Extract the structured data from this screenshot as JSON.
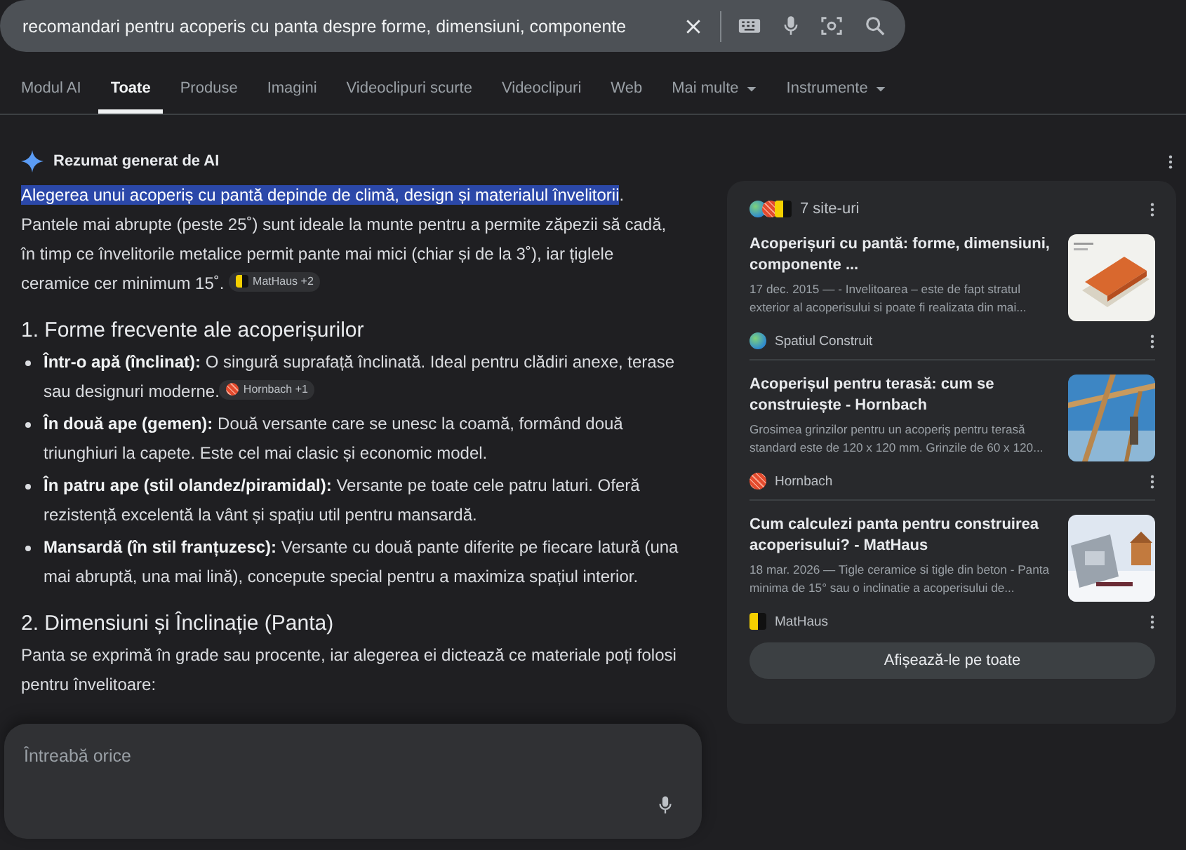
{
  "search": {
    "query": "recomandari pentru acoperis cu panta despre forme, dimensiuni, componente"
  },
  "tabs": [
    {
      "label": "Modul AI",
      "selected": false,
      "dropdown": false
    },
    {
      "label": "Toate",
      "selected": true,
      "dropdown": false
    },
    {
      "label": "Produse",
      "selected": false,
      "dropdown": false
    },
    {
      "label": "Imagini",
      "selected": false,
      "dropdown": false
    },
    {
      "label": "Videoclipuri scurte",
      "selected": false,
      "dropdown": false
    },
    {
      "label": "Videoclipuri",
      "selected": false,
      "dropdown": false
    },
    {
      "label": "Web",
      "selected": false,
      "dropdown": false
    },
    {
      "label": "Mai multe",
      "selected": false,
      "dropdown": true
    },
    {
      "label": "Instrumente",
      "selected": false,
      "dropdown": true
    }
  ],
  "ai_overview": {
    "title": "Rezumat generat de AI",
    "intro": {
      "highlight": "Alegerea unui acoperiș cu pantă depinde de climă, design și materialul învelitorii",
      "text": ". Pantele mai abrupte (peste 25˚) sunt ideale la munte pentru a permite zăpezii să cadă, în timp ce învelitorile metalice permit pante mai mici (chiar și de la 3˚), iar țiglele ceramice cer minimum 15˚.",
      "source": {
        "label": "MatHaus +2",
        "kind": "mathaus"
      }
    },
    "sections": [
      {
        "heading": "1. Forme frecvente ale acoperișurilor",
        "bullets": [
          {
            "text": "**Într-o apă (înclinat):** O singură suprafață înclinată. Ideal pentru clădiri anexe, terase sau designuri moderne.",
            "source": {
              "label": "Hornbach +1",
              "kind": "hornbach"
            }
          },
          {
            "text": "**În două ape (gemen):** Două versante care se unesc la coamă, formând două triunghiuri la capete. Este cel mai clasic și economic model."
          },
          {
            "text": "**În patru ape (stil olandez/piramidal):** Versante pe toate cele patru laturi. Oferă rezistență excelentă la vânt și spațiu util pentru mansardă."
          },
          {
            "text": "**Mansardă (în stil franțuzesc):** Versante cu două pante diferite pe fiecare latură (una mai abruptă, una mai lină), concepute special pentru a maximiza spațiul interior."
          }
        ]
      },
      {
        "heading": "2. Dimensiuni și Înclinație (Panta)",
        "paragraph": "Panta se exprimă în grade sau procente, iar alegerea ei dictează ce materiale poți folosi pentru învelitoare:"
      }
    ]
  },
  "ask": {
    "placeholder": "Întreabă orice"
  },
  "sources_panel": {
    "count_label": "7 site-uri",
    "icons": [
      {
        "kind": "globe"
      },
      {
        "kind": "hornbach"
      },
      {
        "kind": "mathaus"
      }
    ],
    "results": [
      {
        "title": "Acoperișuri cu pantă: forme, dimensiuni, componente ...",
        "snippet": "17 dec. 2015 — - Invelitoarea – este de fapt stratul exterior al acoperisului si poate fi realizata din mai...",
        "site": {
          "name": "Spatiul Construit",
          "kind": "globe"
        }
      },
      {
        "title": "Acoperișul pentru terasă: cum se construiește - Hornbach",
        "snippet": "Grosimea grinzilor pentru un acoperiș pentru terasă standard este de 120 x 120 mm. Grinzile de 60 x 120...",
        "site": {
          "name": "Hornbach",
          "kind": "hornbach"
        }
      },
      {
        "title": "Cum calculezi panta pentru construirea acoperisului? - MatHaus",
        "snippet": "18 mar. 2026 — Tigle ceramice si tigle din beton - Panta minima de 15° sau o inclinatie a acoperisului de...",
        "site": {
          "name": "MatHaus",
          "kind": "mathaus"
        }
      }
    ],
    "button": "Afișează-le pe toate"
  }
}
